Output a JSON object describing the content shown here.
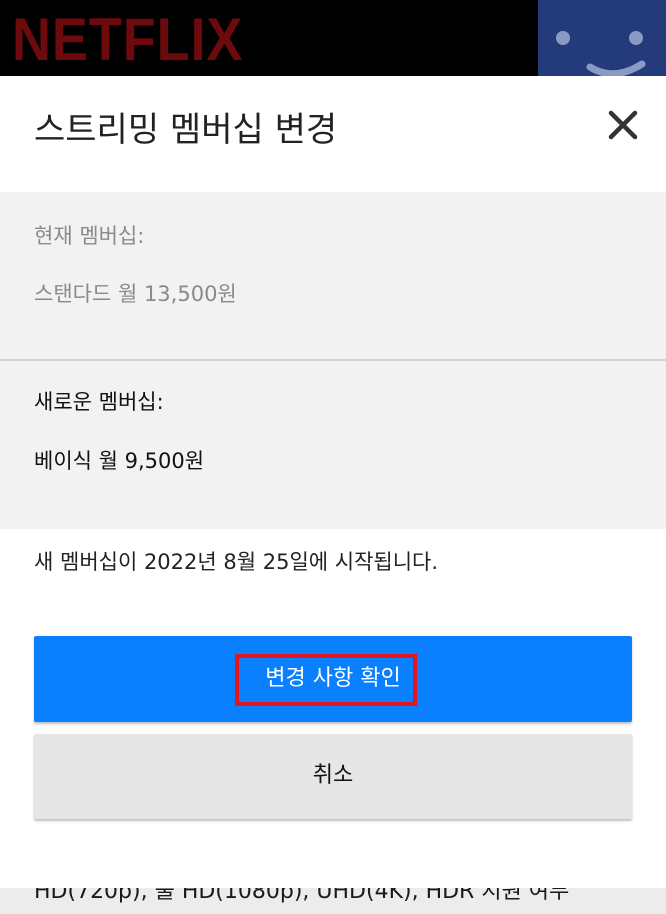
{
  "header": {
    "logo_text": "NETFLIX",
    "logo_color": "#6d0a0e",
    "profile_icon": "smiley-face-icon"
  },
  "modal": {
    "title": "스트리밍 멤버십 변경",
    "close_icon": "close-icon",
    "current_label": "현재 멤버십:",
    "current_value": "스탠다드 월 13,500원",
    "new_label": "새로운 멤버십:",
    "new_value": "베이식 월 9,500원",
    "start_note": "새 멤버십이 2022년 8월 25일에 시작됩니다.",
    "confirm_label": "변경 사항 확인",
    "cancel_label": "취소",
    "accent_color": "#0a80ff",
    "highlight_color": "#e2141d"
  },
  "background_page": {
    "partial_text": "HD(720p), 풀 HD(1080p), UHD(4K), HDR 지원 여부"
  }
}
